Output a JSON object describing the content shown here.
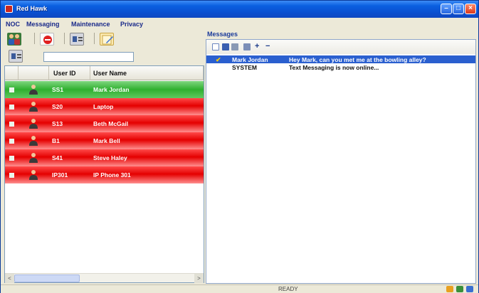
{
  "window": {
    "title": "Red Hawk",
    "min_glyph": "–",
    "max_glyph": "□",
    "close_glyph": "×"
  },
  "menu": {
    "items": [
      "NOC",
      "Messaging",
      "Maintenance",
      "Privacy"
    ]
  },
  "left": {
    "toolbar_icons": [
      "users-icon",
      "no-entry-icon",
      "contact-card-icon",
      "edit-note-icon"
    ],
    "filter_icon": "contact-card-icon",
    "filter_value": "",
    "grid": {
      "columns": [
        "",
        "",
        "User ID",
        "User Name"
      ],
      "rows": [
        {
          "id": "SS1",
          "name": "Mark Jordan",
          "status": "green"
        },
        {
          "id": "S20",
          "name": "Laptop",
          "status": "red"
        },
        {
          "id": "S13",
          "name": "Beth McGail",
          "status": "red"
        },
        {
          "id": "B1",
          "name": "Mark Bell",
          "status": "red"
        },
        {
          "id": "S41",
          "name": "Steve Haley",
          "status": "red"
        },
        {
          "id": "IP301",
          "name": "IP Phone 301",
          "status": "red"
        }
      ]
    },
    "scroll_left_glyph": "<",
    "scroll_right_glyph": ">"
  },
  "messages": {
    "title": "Messages",
    "toolbar_icons": [
      "new-icon",
      "save-icon",
      "print-icon",
      "copy-icon",
      "add-icon",
      "remove-icon"
    ],
    "add_glyph": "+",
    "remove_glyph": "−",
    "check_glyph": "✔",
    "rows": [
      {
        "sender": "Mark Jordan",
        "text": "Hey Mark, can you met me at the bowling alley?",
        "selected": true
      },
      {
        "sender": "SYSTEM",
        "text": "Text Messaging is now online...",
        "selected": false
      }
    ]
  },
  "status": {
    "text": "READY"
  },
  "colors": {
    "online": "#2fb02f",
    "offline": "#e40000",
    "selection": "#2a5fcf",
    "titlebar": "#0a5fe0"
  }
}
